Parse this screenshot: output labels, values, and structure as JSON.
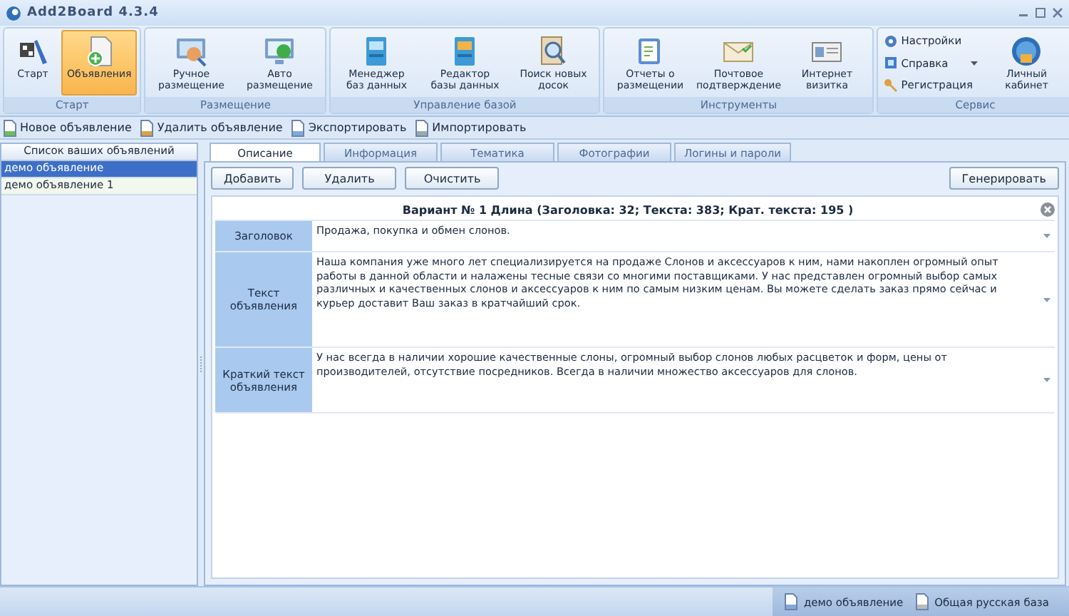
{
  "window": {
    "title": "Add2Board 4.3.4"
  },
  "ribbon": {
    "groups": [
      {
        "label": "Старт",
        "buttons": [
          {
            "label": "Старт",
            "selected": false
          },
          {
            "label": "Объявления",
            "selected": true
          }
        ]
      },
      {
        "label": "Размещение",
        "buttons": [
          {
            "label": "Ручное размещение",
            "selected": false
          },
          {
            "label": "Авто размещение",
            "selected": false
          }
        ]
      },
      {
        "label": "Управление базой",
        "buttons": [
          {
            "label": "Менеджер баз данных",
            "selected": false
          },
          {
            "label": "Редактор базы данных",
            "selected": false
          },
          {
            "label": "Поиск новых досок",
            "selected": false
          }
        ]
      },
      {
        "label": "Инструменты",
        "buttons": [
          {
            "label": "Отчеты о размещении",
            "selected": false
          },
          {
            "label": "Почтовое подтверждение",
            "selected": false
          },
          {
            "label": "Интернет визитка",
            "selected": false
          }
        ]
      },
      {
        "label": "Сервис",
        "small_items": [
          "Настройки",
          "Справка",
          "Регистрация"
        ],
        "buttons": [
          {
            "label": "Личный кабинет",
            "selected": false
          }
        ]
      }
    ]
  },
  "toolbar": [
    "Новое объявление",
    "Удалить объявление",
    "Экспортировать",
    "Импортировать"
  ],
  "ads_list": {
    "header": "Список ваших объявлений",
    "items": [
      {
        "label": "демо объявление",
        "selected": true
      },
      {
        "label": "демо объявление  1",
        "selected": false
      }
    ]
  },
  "tabs": [
    {
      "label": "Описание",
      "selected": true
    },
    {
      "label": "Информация",
      "selected": false
    },
    {
      "label": "Тематика",
      "selected": false
    },
    {
      "label": "Фотографии",
      "selected": false
    },
    {
      "label": "Логины и пароли",
      "selected": false
    }
  ],
  "actions": [
    "Добавить",
    "Удалить",
    "Очистить"
  ],
  "generate": "Генерировать",
  "variant_title": "Вариант № 1 Длина (Заголовка: 32; Текста: 383; Крат. текста: 195 )",
  "fields": [
    {
      "label": "Заголовок",
      "value": "Продажа, покупка и обмен слонов."
    },
    {
      "label": "Текст объявления",
      "value": "Наша компания уже много лет специализируется на продаже Слонов и аксессуаров к ним, нами накоплен огромный опыт работы в данной области и налажены тесные связи со многими поставщиками.  У нас представлен огромный выбор самых различных и качественных слонов и аксессуаров к ним по самым низким ценам. Вы можете сделать заказ прямо сейчас и курьер доставит Ваш заказ в кратчайший срок."
    },
    {
      "label": "Краткий текст объявления",
      "value": "У нас всегда в наличии хорошие качественные слоны, огромный выбор слонов любых расцветок и форм, цены от производителей, отсутствие посредников. Всегда в наличии множество аксессуаров для слонов."
    }
  ],
  "status_bar": [
    "демо объявление",
    "Общая русская база"
  ]
}
